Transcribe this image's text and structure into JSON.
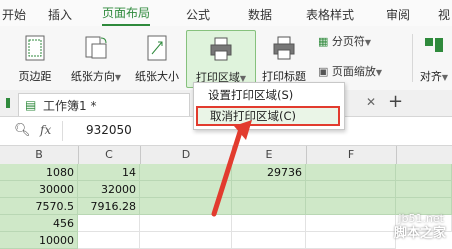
{
  "tabs": [
    "开始",
    "插入",
    "页面布局",
    "公式",
    "数据",
    "表格样式",
    "审阅",
    "视"
  ],
  "active_tab": "页面布局",
  "ribbon": {
    "margins": "页边距",
    "orientation": "纸张方向",
    "size": "纸张大小",
    "print_area": "打印区域",
    "print_titles": "打印标题",
    "page_break": "分页符",
    "page_scale": "页面缩放",
    "align": "对齐"
  },
  "print_area_menu": {
    "set": "设置打印区域(S)",
    "cancel": "取消打印区域(C)"
  },
  "workbook_tab": "工作簿1 *",
  "formula_bar": {
    "name_icon": "search-icon",
    "fx": "fx",
    "value": "932050"
  },
  "columns": [
    "B",
    "C",
    "D",
    "E",
    "F"
  ],
  "cells": {
    "r1": {
      "b": "1080",
      "c": "14",
      "e": "29736"
    },
    "r2": {
      "b": "30000",
      "c": "32000"
    },
    "r3": {
      "b": "7570.5",
      "c": "7916.28"
    },
    "r4": {
      "b": "456"
    },
    "r5": {
      "b": "10000"
    }
  },
  "watermark": {
    "site": "jb51.net",
    "brand": "脚本之家"
  },
  "colors": {
    "accent": "#2f8a3c",
    "highlight_red": "#e23b2e",
    "cell_green": "#cfe8c8"
  }
}
